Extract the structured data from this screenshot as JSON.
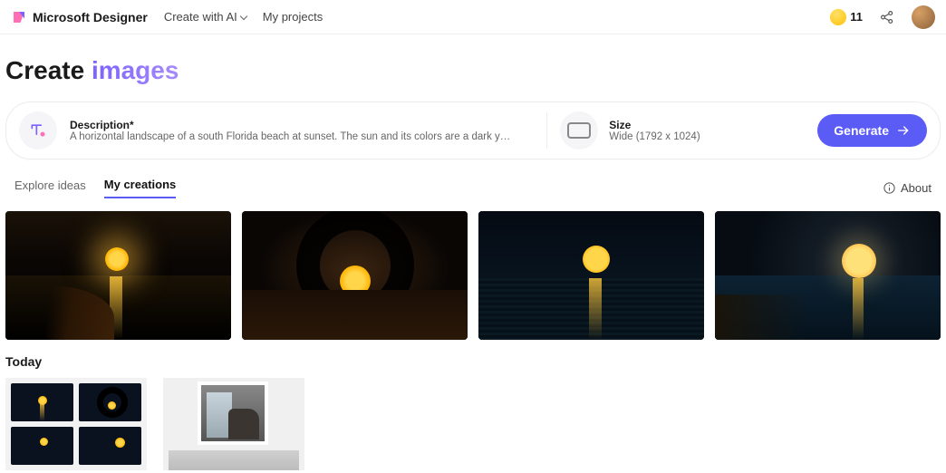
{
  "header": {
    "app_name": "Microsoft Designer",
    "nav_create": "Create with AI",
    "nav_projects": "My projects",
    "coins": "11"
  },
  "page": {
    "title_plain": "Create ",
    "title_accent": "images"
  },
  "prompt": {
    "desc_label": "Description*",
    "desc_text": "A horizontal landscape of a south Florida beach at sunset. The sun and its colors are a dark yellow and the sky surrounding…",
    "size_label": "Size",
    "size_value": "Wide (1792 x 1024)",
    "generate_label": "Generate"
  },
  "tabs": {
    "explore": "Explore ideas",
    "mine": "My creations",
    "about": "About"
  },
  "sections": {
    "today": "Today"
  }
}
